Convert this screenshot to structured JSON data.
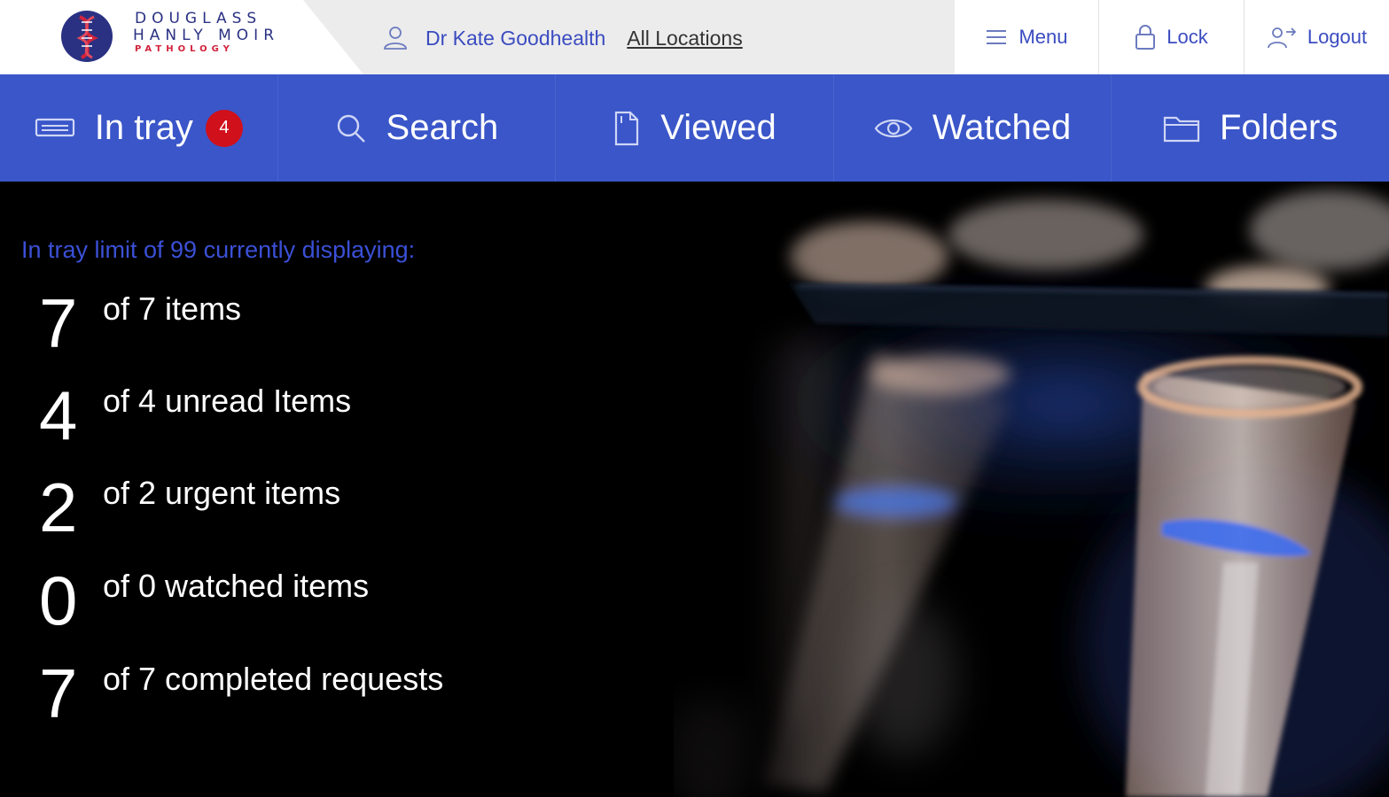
{
  "brand": {
    "line1": "DOUGLASS",
    "line2": "HANLY MOIR",
    "line3": "PATHOLOGY",
    "primary_color": "#2a3182",
    "accent_color": "#d2233c"
  },
  "header": {
    "user_icon": "user-icon",
    "user_name": "Dr Kate Goodhealth",
    "locations_link": "All Locations",
    "actions": [
      {
        "label": "Menu",
        "icon": "hamburger-icon"
      },
      {
        "label": "Lock",
        "icon": "lock-icon"
      },
      {
        "label": "Logout",
        "icon": "logout-icon"
      }
    ]
  },
  "nav": {
    "color": "#3a56c9",
    "tabs": [
      {
        "label": "In tray",
        "icon": "inbox-icon",
        "badge": "4"
      },
      {
        "label": "Search",
        "icon": "search-icon"
      },
      {
        "label": "Viewed",
        "icon": "document-icon"
      },
      {
        "label": "Watched",
        "icon": "eye-icon"
      },
      {
        "label": "Folders",
        "icon": "folder-icon"
      }
    ]
  },
  "summary": {
    "limit_text": "In tray limit of 99 currently displaying:",
    "stats": [
      {
        "number": "7",
        "label": "of 7 items"
      },
      {
        "number": "4",
        "label": "of 4 unread Items"
      },
      {
        "number": "2",
        "label": "of 2 urgent items"
      },
      {
        "number": "0",
        "label": "of 0 watched items"
      },
      {
        "number": "7",
        "label": "of 7 completed requests"
      }
    ]
  }
}
